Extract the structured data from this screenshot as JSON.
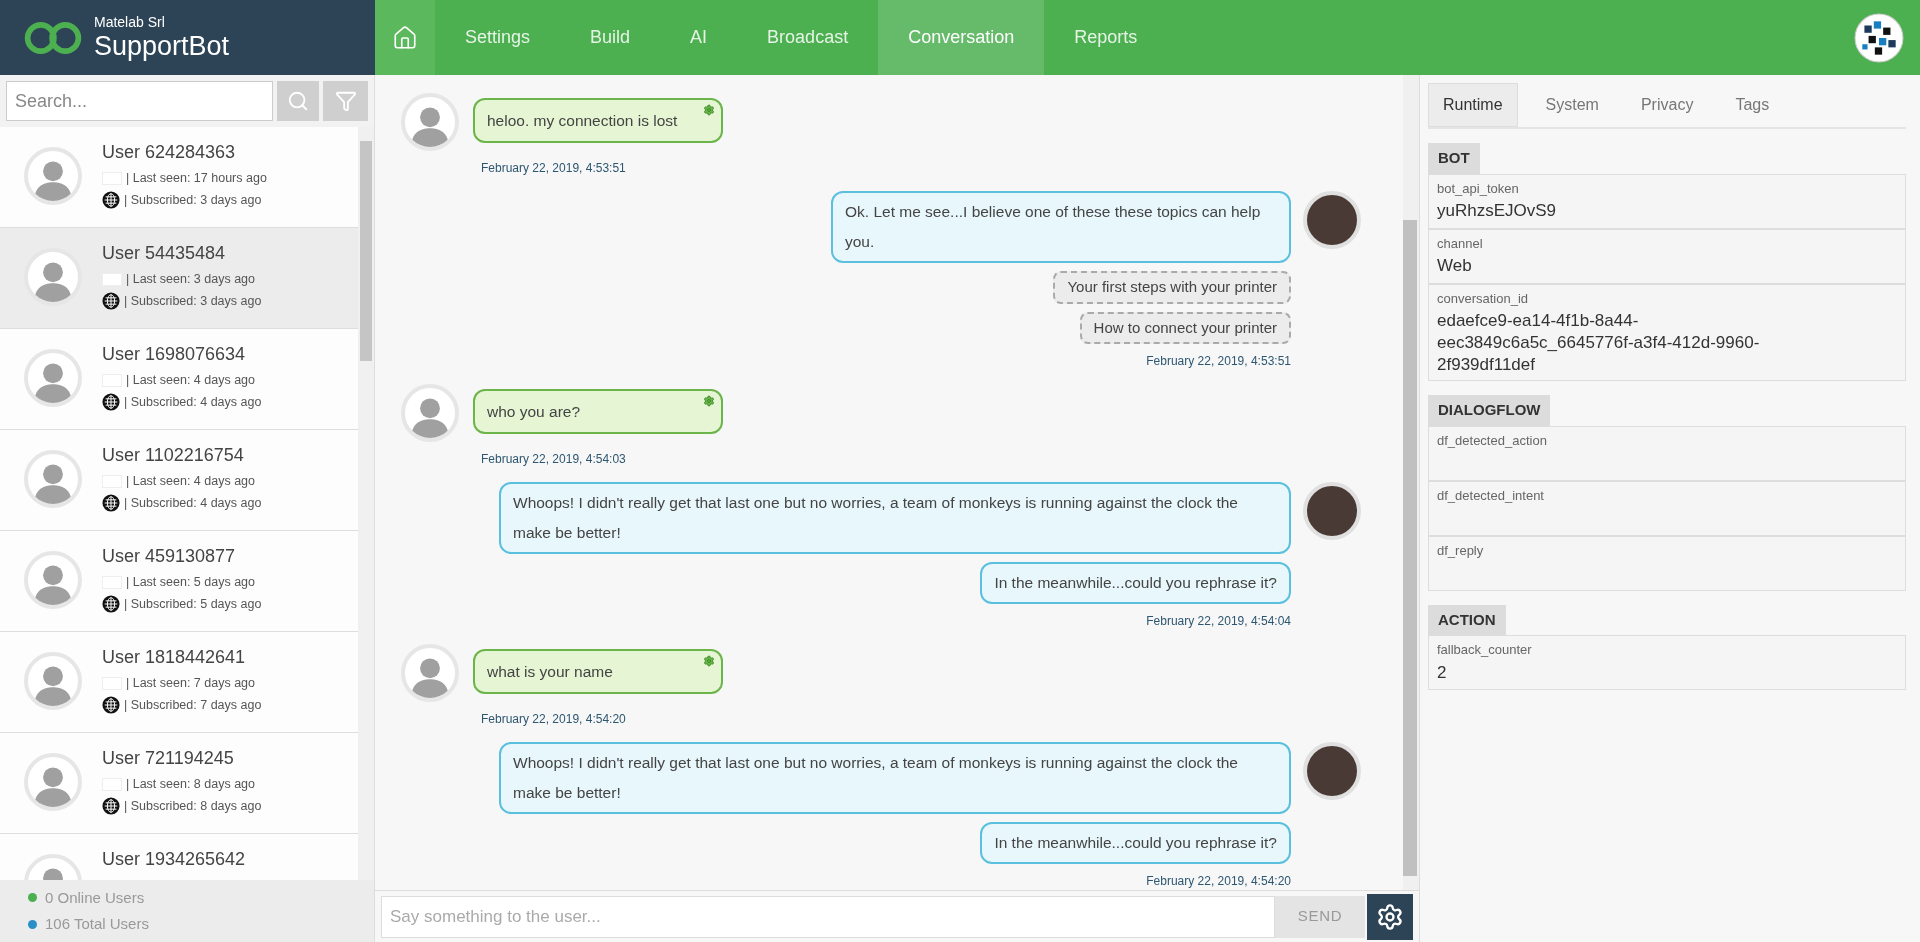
{
  "brand": {
    "company": "Matelab Srl",
    "product": "SupportBot"
  },
  "nav": [
    {
      "kind": "home",
      "selected": false
    },
    {
      "kind": "link",
      "label": "Settings",
      "selected": false
    },
    {
      "kind": "link",
      "label": "Build",
      "selected": false
    },
    {
      "kind": "link",
      "label": "AI",
      "selected": false
    },
    {
      "kind": "link",
      "label": "Broadcast",
      "selected": false
    },
    {
      "kind": "link",
      "label": "Conversation",
      "selected": true
    },
    {
      "kind": "link",
      "label": "Reports",
      "selected": false
    }
  ],
  "search": {
    "placeholder": "Search..."
  },
  "users": [
    {
      "name": "User 624284363",
      "last_seen": "| Last seen: 17 hours ago",
      "subscribed": "| Subscribed: 3 days ago",
      "selected": false
    },
    {
      "name": "User 54435484",
      "last_seen": "| Last seen: 3 days ago",
      "subscribed": "| Subscribed: 3 days ago",
      "selected": true
    },
    {
      "name": "User 1698076634",
      "last_seen": "| Last seen: 4 days ago",
      "subscribed": "| Subscribed: 4 days ago",
      "selected": false
    },
    {
      "name": "User 1102216754",
      "last_seen": "| Last seen: 4 days ago",
      "subscribed": "| Subscribed: 4 days ago",
      "selected": false
    },
    {
      "name": "User 459130877",
      "last_seen": "| Last seen: 5 days ago",
      "subscribed": "| Subscribed: 5 days ago",
      "selected": false
    },
    {
      "name": "User 1818442641",
      "last_seen": "| Last seen: 7 days ago",
      "subscribed": "| Subscribed: 7 days ago",
      "selected": false
    },
    {
      "name": "User 721194245",
      "last_seen": "| Last seen: 8 days ago",
      "subscribed": "| Subscribed: 8 days ago",
      "selected": false
    },
    {
      "name": "User 1934265642",
      "selected": false
    }
  ],
  "stats": [
    {
      "label": "0 Online Users",
      "color": "#4caf50"
    },
    {
      "label": "106 Total Users",
      "color": "#2a8fc7"
    }
  ],
  "messages": [
    {
      "kind": "user",
      "bubbles": [
        "heloo. my connection is lost"
      ],
      "time": "February 22, 2019, 4:53:51"
    },
    {
      "kind": "bot",
      "bubbles": [
        "Ok. Let me see...I believe one of these these topics can help you."
      ],
      "chips": [
        "Your first steps with your printer",
        "How to connect your printer"
      ],
      "time": "February 22, 2019, 4:53:51"
    },
    {
      "kind": "user",
      "bubbles": [
        "who you are?"
      ],
      "time": "February 22, 2019, 4:54:03"
    },
    {
      "kind": "bot",
      "bubbles": [
        "Whoops! I didn't really get that last one but no worries, a team of monkeys is running against the clock the make be better!",
        "In the meanwhile...could you rephrase it?"
      ],
      "time": "February 22, 2019, 4:54:04"
    },
    {
      "kind": "user",
      "bubbles": [
        "what is your name"
      ],
      "time": "February 22, 2019, 4:54:20"
    },
    {
      "kind": "bot",
      "bubbles": [
        "Whoops! I didn't really get that last one but no worries, a team of monkeys is running against the clock the make be better!",
        "In the meanwhile...could you rephrase it?"
      ],
      "time": "February 22, 2019, 4:54:20"
    }
  ],
  "composer": {
    "placeholder": "Say something to the user...",
    "send": "SEND"
  },
  "panel_tabs": [
    {
      "label": "Runtime",
      "selected": true
    },
    {
      "label": "System",
      "selected": false
    },
    {
      "label": "Privacy",
      "selected": false
    },
    {
      "label": "Tags",
      "selected": false
    }
  ],
  "sections": [
    {
      "title": "BOT",
      "fields": [
        {
          "label": "bot_api_token",
          "value": "yuRhzsEJOvS9"
        },
        {
          "label": "channel",
          "value": "Web"
        },
        {
          "label": "conversation_id",
          "value": "edaefce9-ea14-4f1b-8a44-eec3849c6a5c_6645776f-a3f4-412d-9960-2f939df11def"
        }
      ]
    },
    {
      "title": "DIALOGFLOW",
      "fields": [
        {
          "label": "df_detected_action"
        },
        {
          "label": "df_detected_intent"
        },
        {
          "label": "df_reply"
        }
      ]
    },
    {
      "title": "ACTION",
      "fields": [
        {
          "label": "fallback_counter",
          "value": "2"
        }
      ]
    }
  ]
}
